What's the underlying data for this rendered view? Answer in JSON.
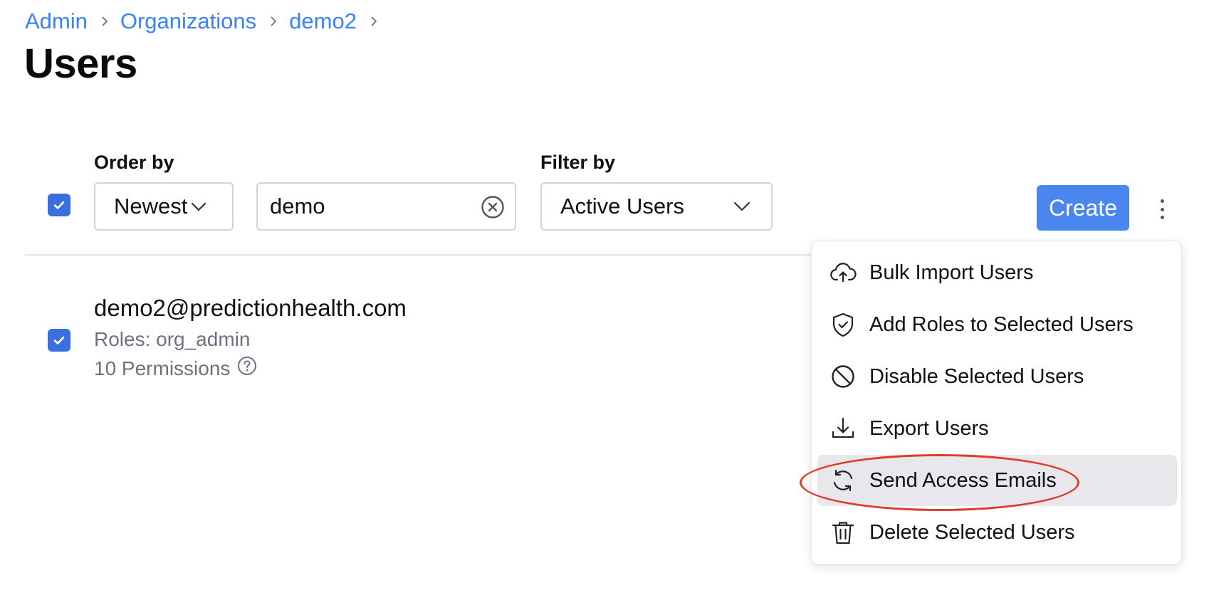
{
  "breadcrumb": {
    "items": [
      "Admin",
      "Organizations",
      "demo2"
    ]
  },
  "page": {
    "title": "Users"
  },
  "toolbar": {
    "order_by_label": "Order by",
    "order_by_value": "Newest",
    "search_value": "demo",
    "filter_by_label": "Filter by",
    "filter_value": "Active Users",
    "create_label": "Create",
    "select_all_checked": true
  },
  "users": [
    {
      "email": "demo2@predictionhealth.com",
      "roles": "Roles: org_admin",
      "permissions": "10 Permissions",
      "checked": true
    }
  ],
  "menu": {
    "items": [
      {
        "label": "Bulk Import Users",
        "icon": "cloud-upload-icon"
      },
      {
        "label": "Add Roles to Selected Users",
        "icon": "shield-check-icon"
      },
      {
        "label": "Disable Selected Users",
        "icon": "ban-icon"
      },
      {
        "label": "Export Users",
        "icon": "download-icon"
      },
      {
        "label": "Send Access Emails",
        "icon": "refresh-icon",
        "highlighted": true
      },
      {
        "label": "Delete Selected Users",
        "icon": "trash-icon"
      }
    ]
  },
  "colors": {
    "accent": "#3b82f6",
    "checkbox": "#3b6fe0",
    "create_button": "#4a86f0",
    "annotation": "#e03a2a",
    "menu_highlight": "#e8e8ec"
  }
}
